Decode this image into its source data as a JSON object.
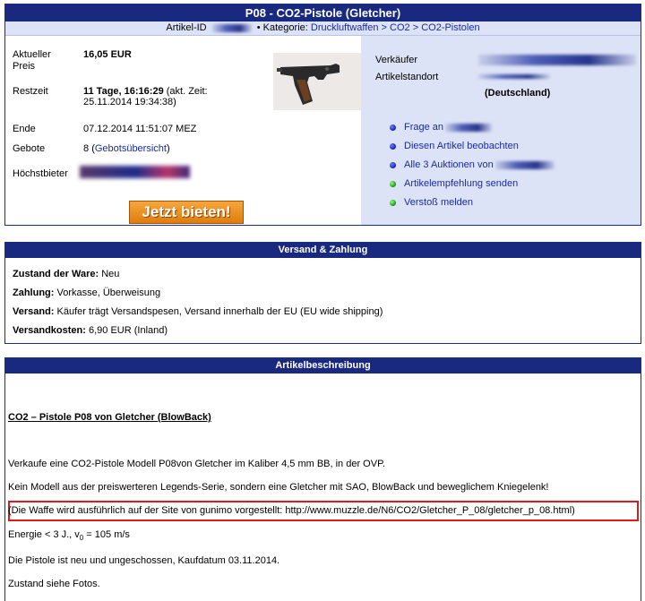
{
  "auction": {
    "title": "P08 - CO2-Pistole (Gletcher)",
    "article_id_label": "Artikel-ID",
    "category_label": "Kategorie:",
    "category_path": "Druckluftwaffen > CO2 > CO2-Pistolen",
    "current_price_label": "Aktueller Preis",
    "current_price": "16,05 EUR",
    "remaining_label": "Restzeit",
    "remaining_value": "11 Tage, 16:16:29",
    "remaining_note": "(akt. Zeit:",
    "remaining_note2": "25.11.2014 19:34:38)",
    "end_label": "Ende",
    "end_value": "07.12.2014 11:51:07 MEZ",
    "bids_label": "Gebote",
    "bids_count": "8",
    "bids_link": "Gebotsübersicht",
    "highest_bidder_label": "Höchstbieter",
    "bid_button": "Jetzt bieten!",
    "seller_label": "Verkäufer",
    "location_label": "Artikelstandort",
    "location_country": "(Deutschland)",
    "actions": [
      {
        "label": "Frage an",
        "icon": "blue-bullet-icon"
      },
      {
        "label": "Diesen Artikel beobachten",
        "icon": "blue-bullet-icon"
      },
      {
        "label": "Alle 3 Auktionen von",
        "icon": "blue-bullet-icon"
      },
      {
        "label": "Artikelempfehlung senden",
        "icon": "green-bullet-icon"
      },
      {
        "label": "Verstoß melden",
        "icon": "green-bullet-icon"
      }
    ]
  },
  "shipping": {
    "title": "Versand & Zahlung",
    "condition_label": "Zustand der Ware:",
    "condition_value": "Neu",
    "payment_label": "Zahlung:",
    "payment_value": "Vorkasse, Überweisung",
    "shipping_label": "Versand:",
    "shipping_value": "Käufer trägt Versandspesen, Versand innerhalb der EU (EU wide shipping)",
    "cost_label": "Versandkosten:",
    "cost_value": "6,90 EUR (Inland)"
  },
  "description": {
    "title": "Artikelbeschreibung",
    "heading": "CO2 – Pistole P08 von Gletcher (BlowBack)",
    "p1": "Verkaufe eine CO2-Pistole Modell P08von Gletcher im Kaliber 4,5 mm BB, in der OVP.",
    "p2": "Kein Modell aus der preiswerteren Legends-Serie, sondern eine Gletcher mit SAO, BlowBack und beweglichem Kniegelenk!",
    "p3": "(Die Waffe wird ausführlich auf der Site von gunimo vorgestellt:  http://www.muzzle.de/N6/CO2/Gletcher_P_08/gletcher_p_08.html)",
    "energy_prefix": "Energie < 3 J., v",
    "energy_sub": "0",
    "energy_suffix": " = 105 m/s",
    "p5": "Die Pistole ist neu und ungeschossen, Kaufdatum 03.11.2014.",
    "p6": "Zustand siehe Fotos."
  },
  "colors": {
    "header_bg": "#1a2980",
    "right_panel_bg": "#dde3f6",
    "highlight_box": "#e01a1a",
    "bid_button": "#e8891a"
  }
}
